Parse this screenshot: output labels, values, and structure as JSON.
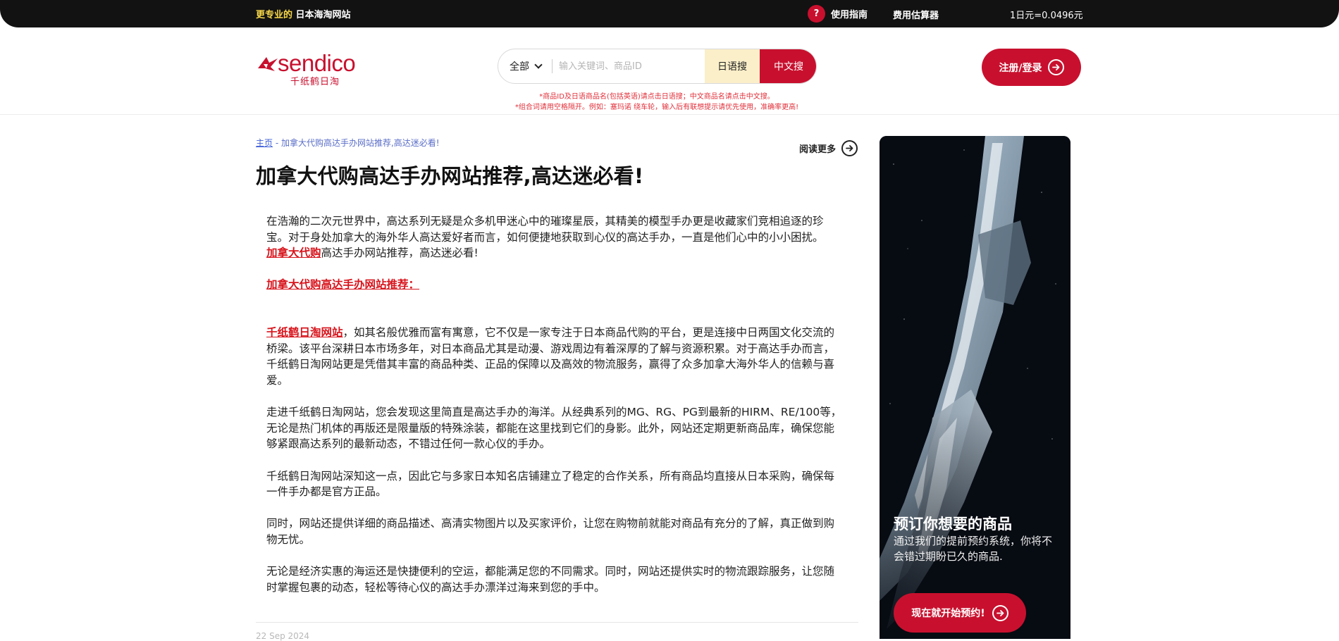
{
  "topbar": {
    "slogan_highlight": "更专业的",
    "slogan_rest": " 日本海淘网站",
    "guide_badge": "?",
    "guide_label": "使用指南",
    "estimator_label": "费用估算器",
    "exchange_rate": "1日元=0.0496元"
  },
  "brand": {
    "logo_word": "sendico",
    "logo_sub": "千纸鹤日淘",
    "color": "#c8102e"
  },
  "search": {
    "category": "全部",
    "placeholder": "输入关键词、商品ID",
    "value": "",
    "btn_jp": "日语搜",
    "btn_cn": "中文搜",
    "hint1": "*商品ID及日语商品名(包括英语)请点击日语搜；中文商品名请点击中文搜。",
    "hint2": "*组合词请用空格隔开。例如：塞玛诺 绕车轮，输入后有联想提示请优先使用，准确率更高!"
  },
  "header": {
    "login_label": "注册/登录"
  },
  "breadcrumb": {
    "home": "主页",
    "separator": " - ",
    "current": "加拿大代购高达手办网站推荐,高达迷必看!"
  },
  "readmore_label": "阅读更多",
  "article": {
    "title": "加拿大代购高达手办网站推荐,高达迷必看!",
    "p1": "在浩瀚的二次元世界中，高达系列无疑是众多机甲迷心中的璀璨星辰，其精美的模型手办更是收藏家们竞相追逐的珍宝。对于身处加拿大的海外华人高达爱好者而言，如何便捷地获取到心仪的高达手办，一直是他们心中的小小困扰。",
    "p1_link": "加拿大代购",
    "p1_tail": "高达手办网站推荐，高达迷必看!",
    "heading_link": "加拿大代购高达手办网站推荐：",
    "p2_link": "千纸鹤日淘网站",
    "p2": "，如其名般优雅而富有寓意，它不仅是一家专注于日本商品代购的平台，更是连接中日两国文化交流的桥梁。该平台深耕日本市场多年，对日本商品尤其是动漫、游戏周边有着深厚的了解与资源积累。对于高达手办而言，千纸鹤日淘网站更是凭借其丰富的商品种类、正品的保障以及高效的物流服务，赢得了众多加拿大海外华人的信赖与喜爱。",
    "p3": "走进千纸鹤日淘网站，您会发现这里简直是高达手办的海洋。从经典系列的MG、RG、PG到最新的HIRM、RE/100等，无论是热门机体的再版还是限量版的特殊涂装，都能在这里找到它们的身影。此外，网站还定期更新商品库，确保您能够紧跟高达系列的最新动态，不错过任何一款心仪的手办。",
    "p4": "千纸鹤日淘网站深知这一点，因此它与多家日本知名店铺建立了稳定的合作关系，所有商品均直接从日本采购，确保每一件手办都是官方正品。",
    "p5": "同时，网站还提供详细的商品描述、高清实物图片以及买家评价，让您在购物前就能对商品有充分的了解，真正做到购物无忧。",
    "p6": "无论是经济实惠的海运还是快捷便利的空运，都能满足您的不同需求。同时，网站还提供实时的物流跟踪服务，让您随时掌握包裹的动态，轻松等待心仪的高达手办漂洋过海来到您的手中。",
    "date": "22 Sep 2024"
  },
  "promo": {
    "title": "预订你想要的商品",
    "desc": "通过我们的提前预约系统，你将不会错过期盼已久的商品.",
    "cta": "现在就开始预约!"
  }
}
